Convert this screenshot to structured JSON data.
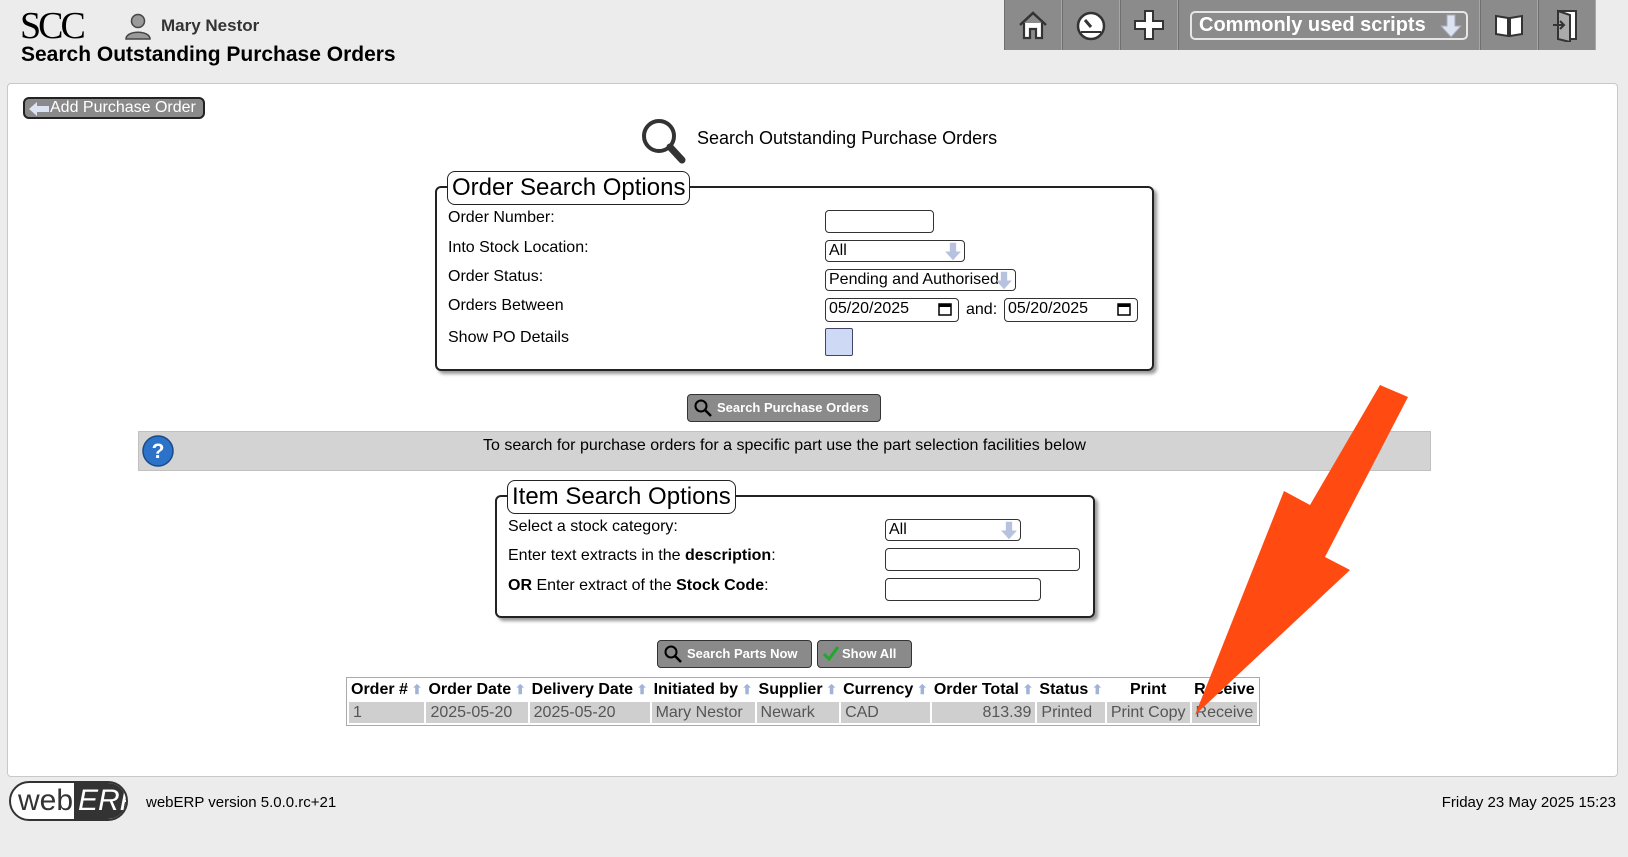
{
  "header": {
    "logo_text": "SCC",
    "user_name": "Mary Nestor",
    "page_title": "Search Outstanding Purchase Orders",
    "toolbar": {
      "home_icon": "home-icon",
      "dashboard_icon": "speedometer-icon",
      "add_icon": "plus-icon",
      "scripts_label": "Commonly used scripts",
      "manual_icon": "book-icon",
      "logout_icon": "exit-door-icon"
    }
  },
  "main": {
    "add_po_label": "Add Purchase Order",
    "heading": "Search Outstanding Purchase Orders",
    "order_search": {
      "legend": "Order Search Options",
      "order_number_label": "Order Number:",
      "order_number_value": "",
      "stock_location_label": "Into Stock Location:",
      "stock_location_value": "All",
      "order_status_label": "Order Status:",
      "order_status_value": "Pending and Authorised",
      "orders_between_label": "Orders Between",
      "date_from": "05/20/2025",
      "and_label": "and:",
      "date_to": "05/20/2025",
      "show_details_label": "Show PO Details"
    },
    "search_po_button": "Search Purchase Orders",
    "help_text": "To search for purchase orders for a specific part use the part selection facilities below",
    "item_search": {
      "legend": "Item Search Options",
      "category_label": "Select a stock category:",
      "category_value": "All",
      "desc_label_prefix": "Enter text extracts in the ",
      "desc_label_bold": "description",
      "desc_label_suffix": ":",
      "desc_value": "",
      "code_label_prefix": "OR",
      "code_label_mid": " Enter extract of the ",
      "code_label_bold": "Stock Code",
      "code_label_suffix": ":",
      "code_value": ""
    },
    "search_parts_button": "Search Parts Now",
    "show_all_button": "Show All",
    "table": {
      "headers": [
        "Order #",
        "Order Date",
        "Delivery Date",
        "Initiated by",
        "Supplier",
        "Currency",
        "Order Total",
        "Status",
        "Print",
        "Receive"
      ],
      "rows": [
        [
          "1",
          "2025-05-20",
          "2025-05-20",
          "Mary Nestor",
          "Newark",
          "CAD",
          "813.39",
          "Printed",
          "Print Copy",
          "Receive"
        ]
      ]
    }
  },
  "footer": {
    "logo_web": "web",
    "logo_erp": "ERP",
    "version": "webERP version 5.0.0.rc+21",
    "datetime": "Friday 23 May 2025 15:23"
  },
  "colors": {
    "toolbar_bg": "#8b8b8b",
    "button_bg": "#8a8a8a",
    "help_bar_bg": "#d3d3d3",
    "cell_bg": "#cfcfcf",
    "annotation_arrow": "#ff4a12",
    "checkbox_bg": "#cdd9f5"
  }
}
